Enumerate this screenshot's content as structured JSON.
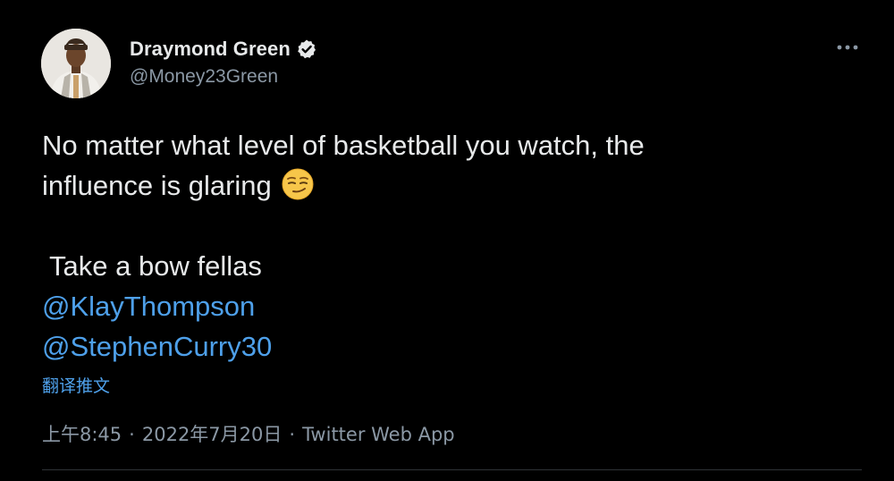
{
  "author": {
    "display_name": "Draymond Green",
    "handle": "@Money23Green",
    "verified": true,
    "verified_icon": "verified-badge-icon"
  },
  "menu": {
    "icon": "more-horizontal-icon"
  },
  "tweet": {
    "line1": "No matter what level of basketball you watch, the",
    "line2": "influence is glaring",
    "emoji": "smirking-face-emoji",
    "line3": " Take a bow fellas",
    "mentions": [
      "@KlayThompson",
      "@StephenCurry30"
    ]
  },
  "translate_label": "翻译推文",
  "meta": {
    "time": "上午8:45",
    "separator": "·",
    "date": "2022年7月20日",
    "source": "Twitter Web App"
  },
  "colors": {
    "background": "#000000",
    "text": "#e7e9ea",
    "secondary_text": "#8b98a5",
    "link": "#4ea0ea",
    "divider": "#2f3336"
  }
}
